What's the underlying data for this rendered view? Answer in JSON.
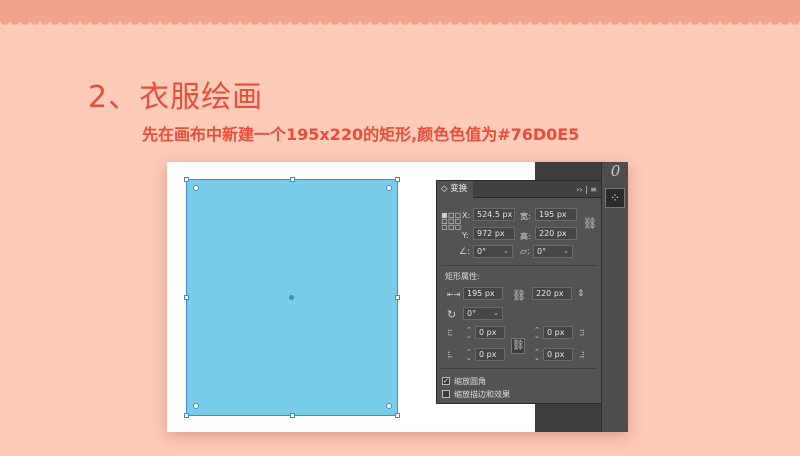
{
  "heading": "2、衣服绘画",
  "subheading": "先在画布中新建一个195x220的矩形,颜色色值为#76D0E5",
  "colors": {
    "background": "#fdcbb8",
    "band": "#f0a48d",
    "accent_text": "#e84e3b",
    "rect_fill": "#7acde8",
    "panel_bg": "#535353"
  },
  "toolstrip": {
    "top_glyph": "0",
    "button_icon": "grid-icon"
  },
  "panel": {
    "tab_label": "◇ 变换",
    "menu_glyph": "›› | ≡",
    "x_label": "X:",
    "x_value": "524.5 px",
    "w_label": "宽:",
    "w_value": "195 px",
    "y_label": "Y:",
    "y_value": "972 px",
    "h_label": "高:",
    "h_value": "220 px",
    "angle_value": "0°",
    "shear_value": "0°",
    "rect_props_label": "矩形属性:",
    "rect_w_value": "195 px",
    "rect_h_value": "220 px",
    "rotate_value": "0°",
    "corner_tl": "0 px",
    "corner_tr": "0 px",
    "corner_bl": "0 px",
    "corner_br": "0 px",
    "scale_corners_label": "缩放圆角",
    "scale_corners_checked": true,
    "scale_strokes_label": "缩放描边和效果",
    "scale_strokes_checked": false
  }
}
